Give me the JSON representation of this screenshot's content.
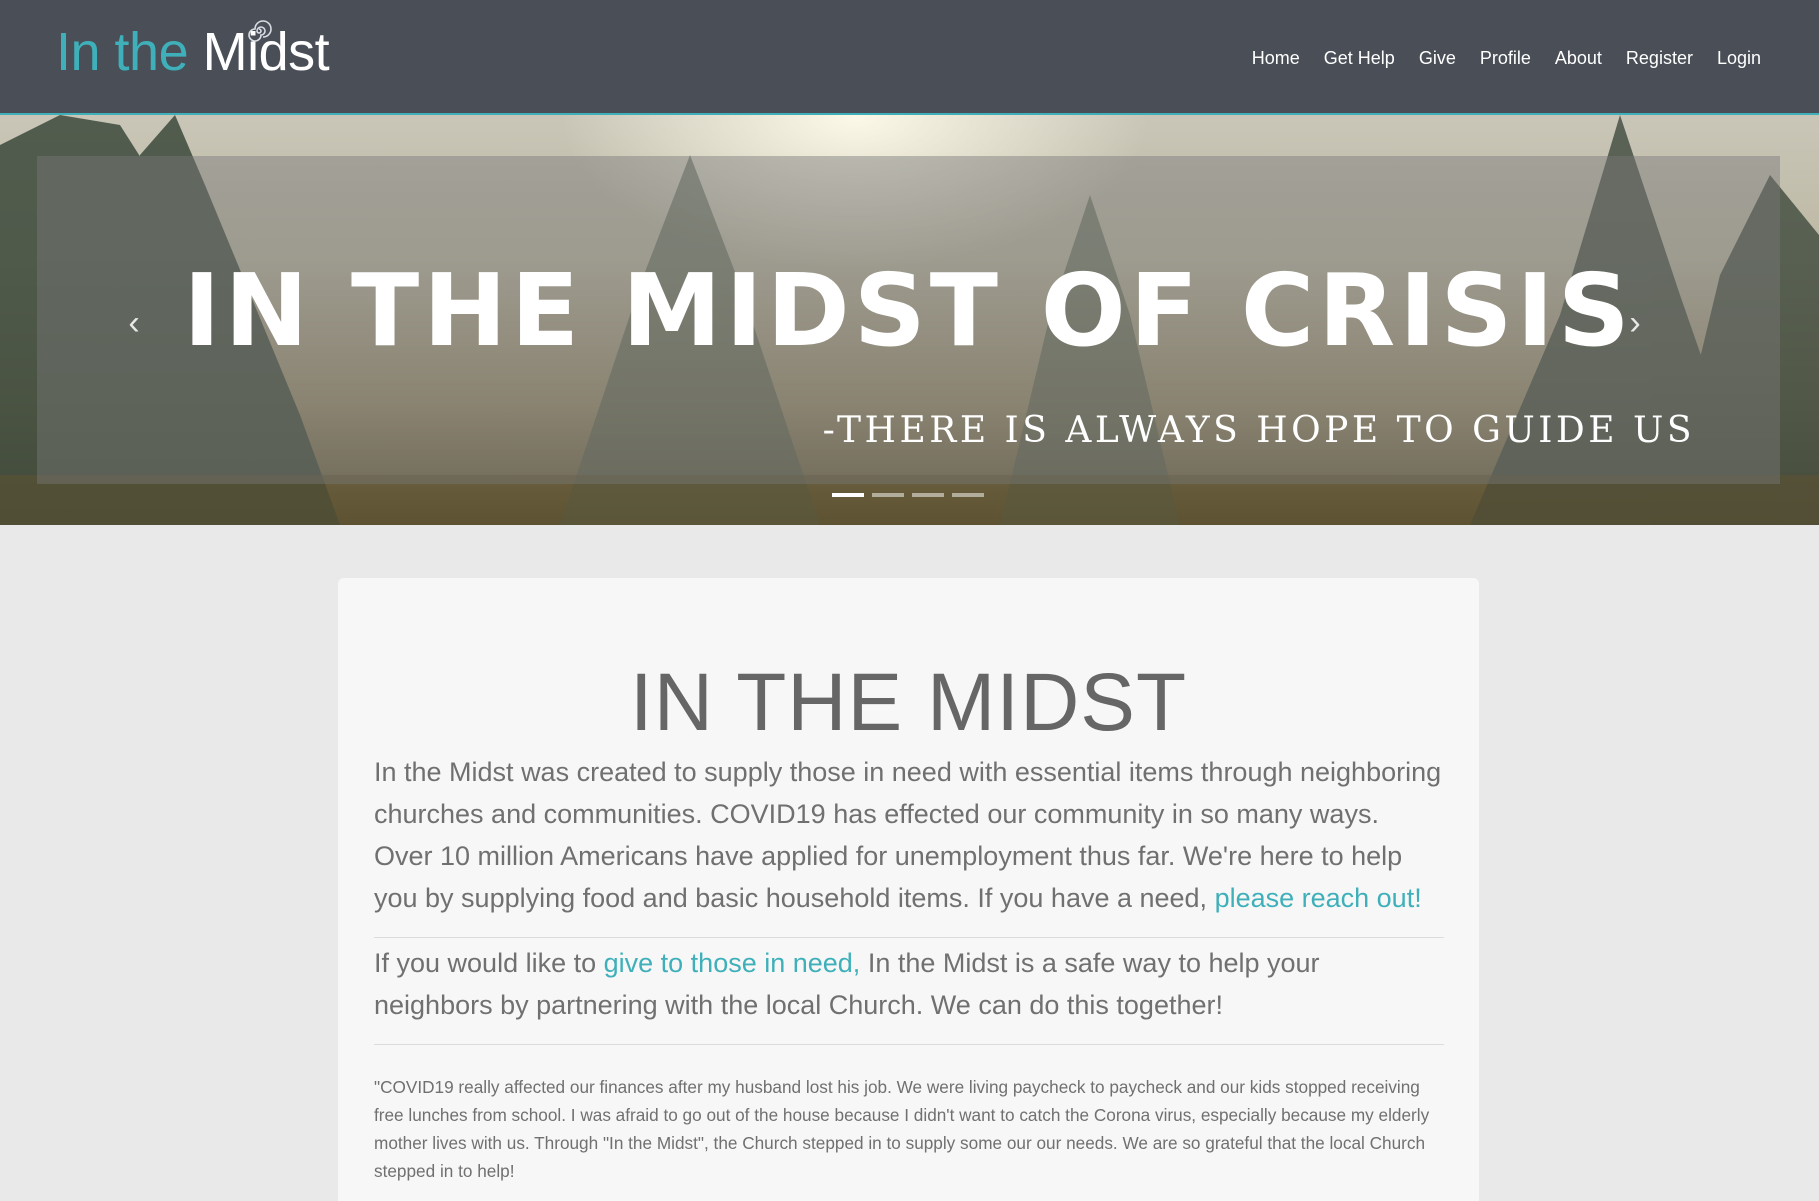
{
  "header": {
    "logo_part1": "In the",
    "logo_part2": "Midst",
    "nav": [
      "Home",
      "Get Help",
      "Give",
      "Profile",
      "About",
      "Register",
      "Login"
    ]
  },
  "hero": {
    "title": "IN THE MIDST OF CRISIS",
    "subtitle": "-THERE IS ALWAYS HOPE TO GUIDE US",
    "prev_icon": "chevron-left-icon",
    "next_icon": "chevron-right-icon",
    "slide_count": 4,
    "active_slide": 1
  },
  "main": {
    "title": "IN THE MIDST",
    "intro_text": "In the Midst was created to supply those in need with essential items through neighboring churches and communities. COVID19 has effected our community in so many ways. Over 10 million Americans have applied for unemployment thus far. We're here to help you by supplying food and basic household items. If you have a need, ",
    "intro_link": "please reach out!",
    "give_prefix": "If you would like to ",
    "give_link": "give to those in need,",
    "give_suffix": " In the Midst is a safe way to help your neighbors by partnering with the local Church. We can do this together!",
    "testimonial": "\"COVID19 really affected our finances after my husband lost his job. We were living paycheck to paycheck and our kids stopped receiving free lunches from school. I was afraid to go out of the house because I didn't want to catch the Corona virus, especially because my elderly mother lives with us. Through \"In the Midst\", the Church stepped in to supply some our our needs. We are so grateful that the local Church stepped in to help!"
  },
  "colors": {
    "navbar": "#494e57",
    "accent": "#3fb0ba",
    "page_bg": "#e9e9e9",
    "card_bg": "#f7f7f7",
    "text": "#707070"
  }
}
